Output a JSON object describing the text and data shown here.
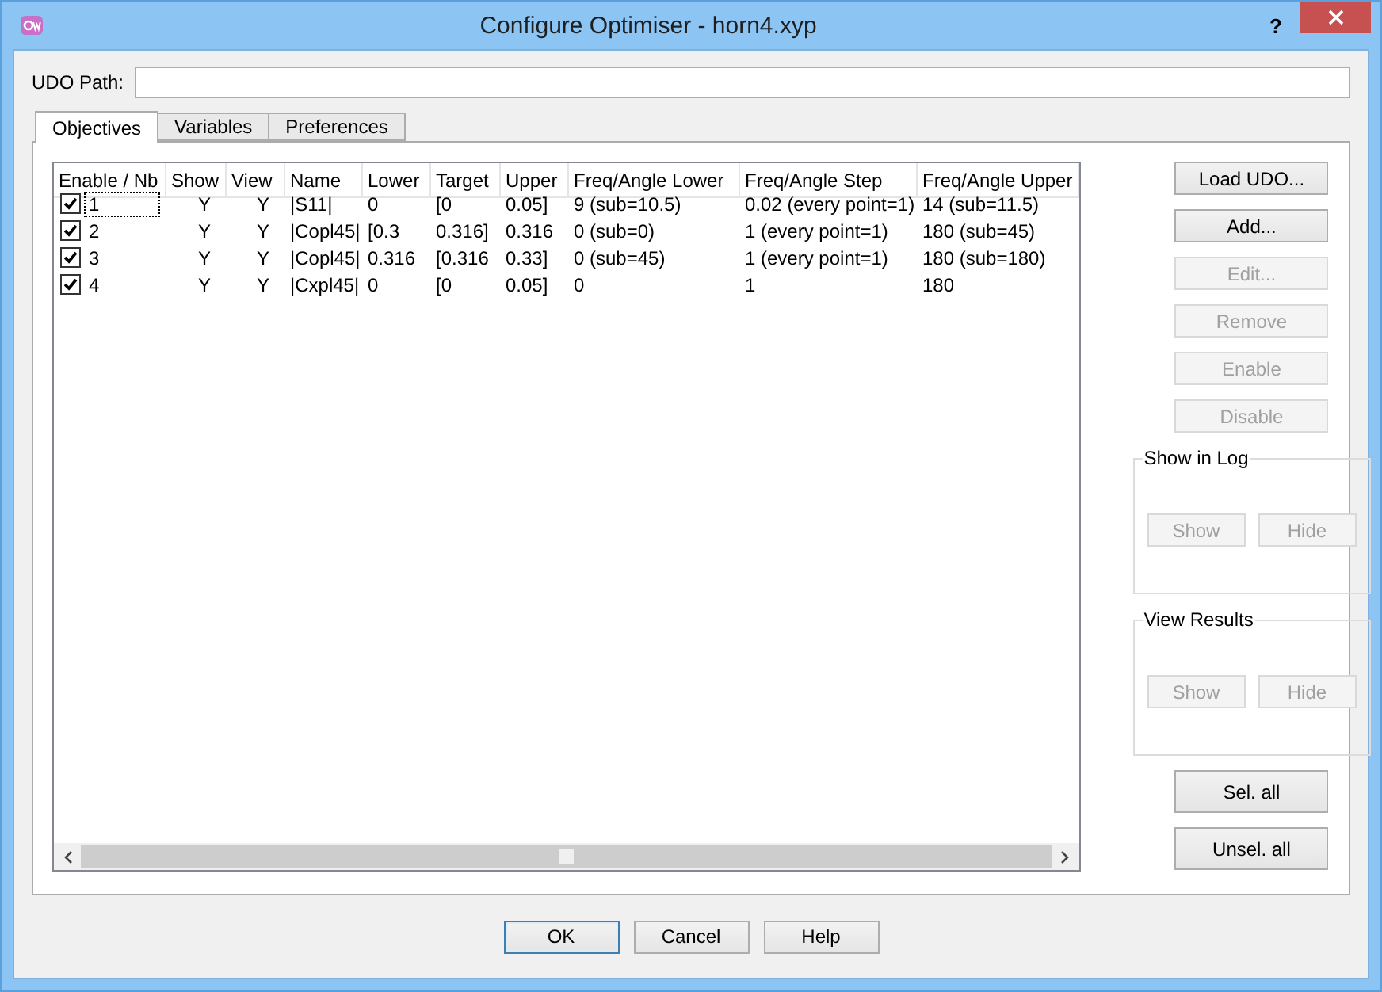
{
  "window": {
    "title": "Configure Optimiser - horn4.xyp",
    "help": "?"
  },
  "udo_path": {
    "label": "UDO Path:"
  },
  "tabs": [
    {
      "label": "Objectives",
      "selected": true
    },
    {
      "label": "Variables",
      "selected": false
    },
    {
      "label": "Preferences",
      "selected": false
    }
  ],
  "table": {
    "columns": [
      "Enable / Nb",
      "Show",
      "View",
      "Name",
      "Lower",
      "Target",
      "Upper",
      "Freq/Angle Lower",
      "Freq/Angle Step",
      "Freq/Angle Upper"
    ],
    "rows": [
      {
        "checked": true,
        "focused": true,
        "cells": [
          "1",
          "Y",
          "Y",
          "|S11|",
          "0",
          "[0",
          "0.05]",
          "9 (sub=10.5)",
          "0.02 (every point=1)",
          "14 (sub=11.5)"
        ]
      },
      {
        "checked": true,
        "focused": false,
        "cells": [
          "2",
          "Y",
          "Y",
          "|Copl45|",
          "[0.3",
          "0.316]",
          "0.316",
          "0 (sub=0)",
          "1 (every point=1)",
          "180 (sub=45)"
        ]
      },
      {
        "checked": true,
        "focused": false,
        "cells": [
          "3",
          "Y",
          "Y",
          "|Copl45|",
          "0.316",
          "[0.316",
          "0.33]",
          "0 (sub=45)",
          "1 (every point=1)",
          "180 (sub=180)"
        ]
      },
      {
        "checked": true,
        "focused": false,
        "cells": [
          "4",
          "Y",
          "Y",
          "|Cxpl45|",
          "0",
          "[0",
          "0.05]",
          "0",
          "1",
          "180"
        ]
      }
    ]
  },
  "side_buttons": [
    {
      "label": "Load UDO...",
      "disabled": false
    },
    {
      "label": "Add...",
      "disabled": false
    },
    {
      "label": "Edit...",
      "disabled": true
    },
    {
      "label": "Remove",
      "disabled": true
    },
    {
      "label": "Enable",
      "disabled": true
    },
    {
      "label": "Disable",
      "disabled": true
    }
  ],
  "groups": [
    {
      "title": "Show in Log",
      "buttons": [
        {
          "label": "Show",
          "disabled": true
        },
        {
          "label": "Hide",
          "disabled": true
        }
      ]
    },
    {
      "title": "View Results",
      "buttons": [
        {
          "label": "Show",
          "disabled": true
        },
        {
          "label": "Hide",
          "disabled": true
        }
      ]
    }
  ],
  "selection_buttons": [
    {
      "label": "Sel. all",
      "disabled": false
    },
    {
      "label": "Unsel. all",
      "disabled": false
    }
  ],
  "dialog_buttons": [
    {
      "label": "OK",
      "default": true
    },
    {
      "label": "Cancel",
      "default": false
    },
    {
      "label": "Help",
      "default": false
    }
  ]
}
